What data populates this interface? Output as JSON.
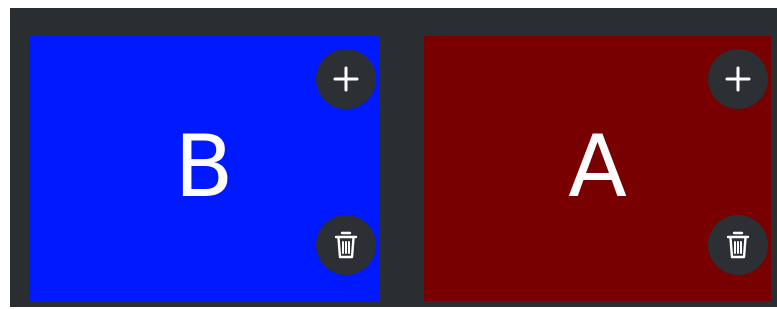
{
  "cards": [
    {
      "letter": "B",
      "color": "#0019ff",
      "add_icon": "plus-icon",
      "delete_icon": "trash-icon"
    },
    {
      "letter": "A",
      "color": "#780000",
      "add_icon": "plus-icon",
      "delete_icon": "trash-icon"
    }
  ],
  "colors": {
    "background": "#2b2e31",
    "button": "#2c2f33",
    "icon": "#ffffff"
  }
}
